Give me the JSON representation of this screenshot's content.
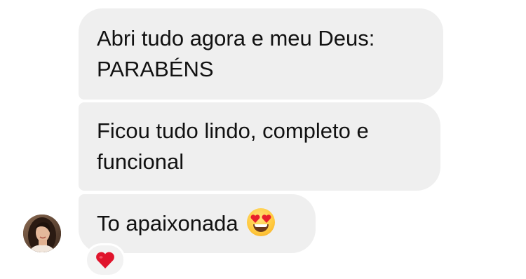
{
  "conversation": {
    "messages": [
      {
        "text": "Abri tudo agora e meu Deus:\nPARABÉNS"
      },
      {
        "text": "Ficou tudo lindo, completo e\nfuncional"
      },
      {
        "text": "To apaixonada",
        "emoji": "heart-eyes-emoji"
      }
    ],
    "sender": {
      "avatar": "avatar"
    },
    "reaction": {
      "icon": "heart-icon",
      "color": "#e0142c"
    }
  },
  "colors": {
    "bubble_background": "#efefef",
    "text": "#111111",
    "background": "#ffffff"
  }
}
